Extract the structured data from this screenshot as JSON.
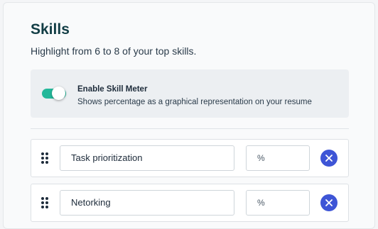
{
  "header": {
    "title": "Skills",
    "subtitle": "Highlight from 6 to 8 of your top skills."
  },
  "skill_meter": {
    "enabled": true,
    "title": "Enable Skill Meter",
    "description": "Shows percentage as a graphical representation on your resume"
  },
  "skills": [
    {
      "name": "Task prioritization",
      "percent_placeholder": "%"
    },
    {
      "name": "Netorking",
      "percent_placeholder": "%"
    }
  ],
  "icons": {
    "drag": "drag-handle-icon",
    "remove": "close-icon"
  },
  "colors": {
    "accent": "#3e55d6",
    "toggle_on": "#23b89a",
    "title": "#123d45"
  }
}
